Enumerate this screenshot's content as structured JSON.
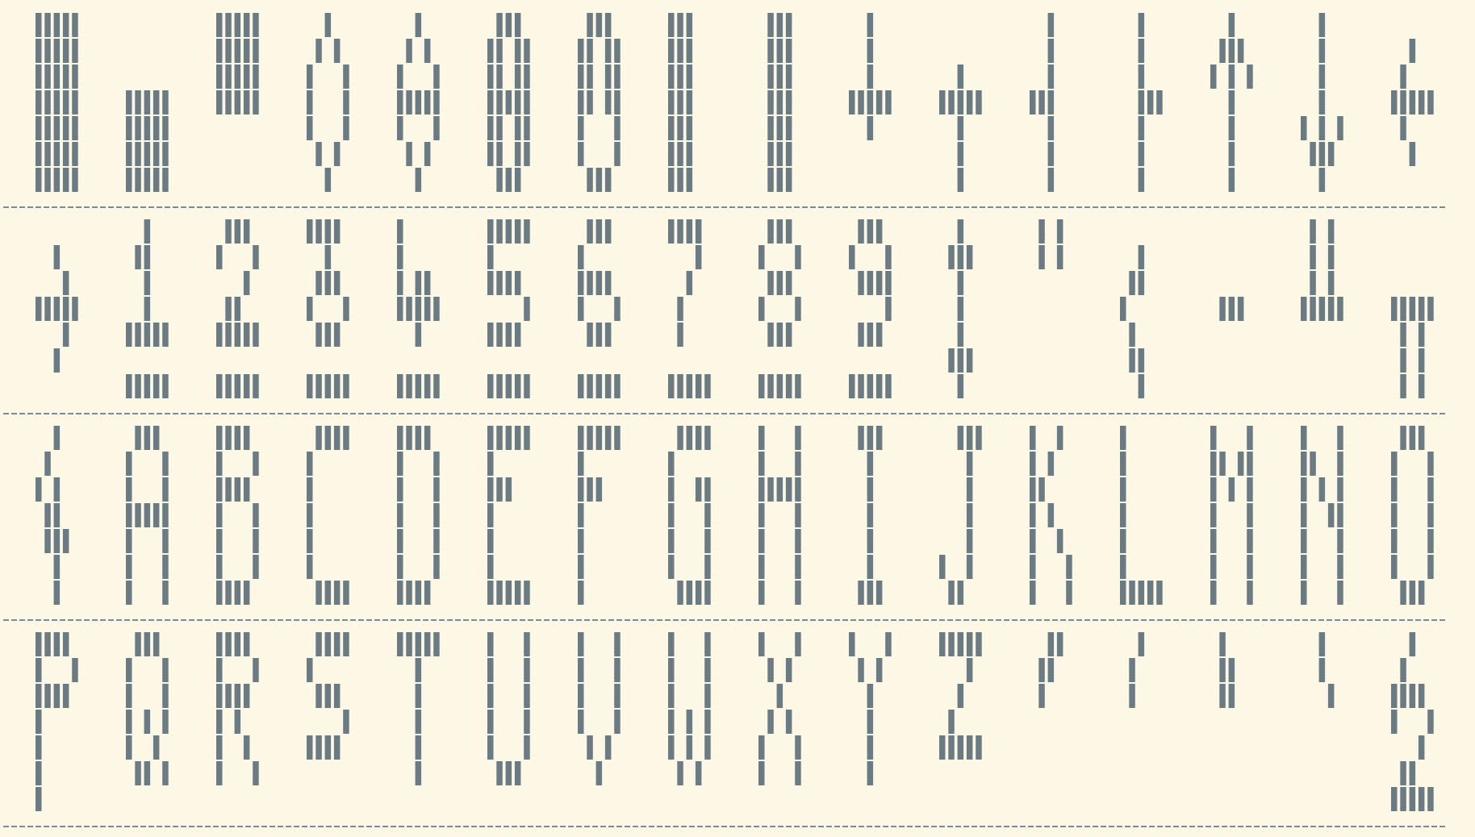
{
  "sheet": {
    "title": "",
    "colors": {
      "background": "#fdf7e6",
      "ink": "#6b7b83",
      "divider": "#7d8a91"
    },
    "cell": {
      "cols": 5,
      "rows": 7
    },
    "glyph_rows": [
      {
        "name": "graphics",
        "glyphs": [
          {
            "name": "full-block",
            "rows": [
              "11111",
              "11111",
              "11111",
              "11111",
              "11111",
              "11111",
              "11111"
            ]
          },
          {
            "name": "lower-block",
            "rows": [
              "00000",
              "00000",
              "00000",
              "11111",
              "11111",
              "11111",
              "11111"
            ]
          },
          {
            "name": "upper-block",
            "rows": [
              "11111",
              "11111",
              "11111",
              "11111",
              "00000",
              "00000",
              "00000"
            ]
          },
          {
            "name": "diamond-outline",
            "rows": [
              "00100",
              "01010",
              "10001",
              "10001",
              "10001",
              "01010",
              "00100"
            ]
          },
          {
            "name": "diamond-split",
            "rows": [
              "00100",
              "01010",
              "10001",
              "11111",
              "10001",
              "01010",
              "00100"
            ]
          },
          {
            "name": "rounded-bar",
            "rows": [
              "01110",
              "11011",
              "11011",
              "11111",
              "11011",
              "11011",
              "01110"
            ]
          },
          {
            "name": "battery",
            "rows": [
              "01110",
              "11011",
              "11011",
              "11011",
              "10001",
              "10001",
              "01110"
            ]
          },
          {
            "name": "left-half-block",
            "rows": [
              "11100",
              "11100",
              "11100",
              "11100",
              "11100",
              "11100",
              "11100"
            ]
          },
          {
            "name": "center-bar",
            "rows": [
              "01110",
              "01110",
              "01110",
              "01110",
              "01110",
              "01110",
              "01110"
            ]
          },
          {
            "name": "box-cross-up",
            "rows": [
              "00100",
              "00100",
              "00100",
              "11111",
              "00100",
              "00000",
              "00000"
            ]
          },
          {
            "name": "box-cross-down",
            "rows": [
              "00000",
              "00000",
              "00100",
              "11111",
              "00100",
              "00100",
              "00100"
            ]
          },
          {
            "name": "box-tee-left",
            "rows": [
              "00100",
              "00100",
              "00100",
              "11100",
              "00100",
              "00100",
              "00100"
            ]
          },
          {
            "name": "box-tee-right",
            "rows": [
              "00100",
              "00100",
              "00100",
              "00111",
              "00100",
              "00100",
              "00100"
            ]
          },
          {
            "name": "arrow-up",
            "rows": [
              "00100",
              "01110",
              "10101",
              "00100",
              "00100",
              "00100",
              "00100"
            ]
          },
          {
            "name": "arrow-down",
            "rows": [
              "00100",
              "00100",
              "00100",
              "00100",
              "10101",
              "01110",
              "00100"
            ]
          },
          {
            "name": "arrow-left",
            "rows": [
              "00000",
              "00100",
              "01000",
              "11111",
              "01000",
              "00100",
              "00000"
            ]
          }
        ]
      },
      {
        "name": "digits",
        "glyphs": [
          {
            "name": "arrow-right",
            "rows": [
              "00000",
              "00100",
              "00010",
              "11111",
              "00010",
              "00100",
              "00000"
            ]
          },
          {
            "name": "digit-1-underline",
            "rows": [
              "00100",
              "01100",
              "00100",
              "00100",
              "11111",
              "00000",
              "11111"
            ]
          },
          {
            "name": "digit-2-underline",
            "rows": [
              "01110",
              "10001",
              "00010",
              "01100",
              "11111",
              "00000",
              "11111"
            ]
          },
          {
            "name": "digit-3-underline",
            "rows": [
              "11110",
              "00100",
              "01110",
              "10001",
              "01110",
              "00000",
              "11111"
            ]
          },
          {
            "name": "digit-4-underline",
            "rows": [
              "10000",
              "10000",
              "10110",
              "11111",
              "00100",
              "00000",
              "11111"
            ]
          },
          {
            "name": "digit-5-underline",
            "rows": [
              "11111",
              "10000",
              "11110",
              "00001",
              "11110",
              "00000",
              "11111"
            ]
          },
          {
            "name": "digit-6-underline",
            "rows": [
              "01110",
              "10000",
              "11110",
              "10001",
              "01110",
              "00000",
              "11111"
            ]
          },
          {
            "name": "digit-7-underline",
            "rows": [
              "11110",
              "00010",
              "00100",
              "01000",
              "01000",
              "00000",
              "11111"
            ]
          },
          {
            "name": "digit-8-underline",
            "rows": [
              "01110",
              "10001",
              "01110",
              "10001",
              "01110",
              "00000",
              "11111"
            ]
          },
          {
            "name": "digit-9-underline",
            "rows": [
              "01110",
              "10001",
              "01111",
              "00001",
              "01110",
              "00000",
              "11111"
            ]
          },
          {
            "name": "updown-arrow",
            "rows": [
              "00100",
              "01110",
              "00100",
              "00100",
              "00100",
              "01110",
              "00100"
            ]
          },
          {
            "name": "double-quote",
            "rows": [
              "01010",
              "01010",
              "00000",
              "00000",
              "00000",
              "00000",
              "00000"
            ]
          },
          {
            "name": "left-brace",
            "rows": [
              "00000",
              "00100",
              "01100",
              "10000",
              "01000",
              "01100",
              "00100"
            ]
          },
          {
            "name": "minus",
            "rows": [
              "00000",
              "00000",
              "00000",
              "01110",
              "00000",
              "00000",
              "00000"
            ]
          },
          {
            "name": "underscore-bar",
            "rows": [
              "01010",
              "01010",
              "01010",
              "11111",
              "00000",
              "00000",
              "00000"
            ]
          },
          {
            "name": "pi",
            "rows": [
              "00000",
              "00000",
              "00000",
              "11111",
              "01010",
              "01010",
              "01010"
            ]
          }
        ]
      },
      {
        "name": "letters-a-o",
        "glyphs": [
          {
            "name": "at-sign",
            "rows": [
              "00100",
              "01000",
              "10100",
              "01100",
              "01110",
              "00100",
              "00100"
            ]
          },
          {
            "name": "letter-a",
            "rows": [
              "01110",
              "10001",
              "10001",
              "11111",
              "10001",
              "10001",
              "10001"
            ]
          },
          {
            "name": "letter-b",
            "rows": [
              "11110",
              "10001",
              "11110",
              "10001",
              "10001",
              "10001",
              "11110"
            ]
          },
          {
            "name": "letter-c",
            "rows": [
              "01111",
              "10000",
              "10000",
              "10000",
              "10000",
              "10000",
              "01111"
            ]
          },
          {
            "name": "letter-d",
            "rows": [
              "11110",
              "10001",
              "10001",
              "10001",
              "10001",
              "10001",
              "11110"
            ]
          },
          {
            "name": "letter-e",
            "rows": [
              "11111",
              "10000",
              "11100",
              "10000",
              "10000",
              "10000",
              "11111"
            ]
          },
          {
            "name": "letter-f",
            "rows": [
              "11111",
              "10000",
              "11100",
              "10000",
              "10000",
              "10000",
              "10000"
            ]
          },
          {
            "name": "letter-g",
            "rows": [
              "01111",
              "10000",
              "10011",
              "10001",
              "10001",
              "10001",
              "01111"
            ]
          },
          {
            "name": "letter-h",
            "rows": [
              "10001",
              "10001",
              "11111",
              "10001",
              "10001",
              "10001",
              "10001"
            ]
          },
          {
            "name": "letter-i",
            "rows": [
              "01110",
              "00100",
              "00100",
              "00100",
              "00100",
              "00100",
              "01110"
            ]
          },
          {
            "name": "letter-j",
            "rows": [
              "00111",
              "00010",
              "00010",
              "00010",
              "00010",
              "10010",
              "01100"
            ]
          },
          {
            "name": "letter-k",
            "rows": [
              "10010",
              "10100",
              "11000",
              "10100",
              "10010",
              "10001",
              "10001"
            ]
          },
          {
            "name": "letter-l",
            "rows": [
              "10000",
              "10000",
              "10000",
              "10000",
              "10000",
              "10000",
              "11111"
            ]
          },
          {
            "name": "letter-m",
            "rows": [
              "10001",
              "11011",
              "10101",
              "10001",
              "10001",
              "10001",
              "10001"
            ]
          },
          {
            "name": "letter-n",
            "rows": [
              "10001",
              "11001",
              "10101",
              "10011",
              "10001",
              "10001",
              "10001"
            ]
          },
          {
            "name": "letter-o",
            "rows": [
              "01110",
              "10001",
              "10001",
              "10001",
              "10001",
              "10001",
              "01110"
            ]
          }
        ]
      },
      {
        "name": "letters-p-z",
        "glyphs": [
          {
            "name": "letter-p",
            "rows": [
              "11110",
              "10001",
              "11110",
              "10000",
              "10000",
              "10000",
              "10000"
            ]
          },
          {
            "name": "letter-q",
            "rows": [
              "01110",
              "10001",
              "10001",
              "10101",
              "10010",
              "01101",
              "00000"
            ]
          },
          {
            "name": "letter-r",
            "rows": [
              "11110",
              "10001",
              "11110",
              "10100",
              "10010",
              "10001",
              "00000"
            ]
          },
          {
            "name": "letter-s",
            "rows": [
              "01111",
              "10000",
              "01110",
              "00001",
              "11110",
              "00000",
              "00000"
            ]
          },
          {
            "name": "letter-t",
            "rows": [
              "11111",
              "00100",
              "00100",
              "00100",
              "00100",
              "00100",
              "00000"
            ]
          },
          {
            "name": "letter-u",
            "rows": [
              "10001",
              "10001",
              "10001",
              "10001",
              "10001",
              "01110",
              "00000"
            ]
          },
          {
            "name": "letter-v",
            "rows": [
              "10001",
              "10001",
              "10001",
              "10001",
              "01010",
              "00100",
              "00000"
            ]
          },
          {
            "name": "letter-w",
            "rows": [
              "10001",
              "10001",
              "10001",
              "10101",
              "10101",
              "01010",
              "00000"
            ]
          },
          {
            "name": "letter-x",
            "rows": [
              "10001",
              "01010",
              "00100",
              "01010",
              "10001",
              "10001",
              "00000"
            ]
          },
          {
            "name": "letter-y",
            "rows": [
              "10001",
              "01010",
              "00100",
              "00100",
              "00100",
              "00100",
              "00000"
            ]
          },
          {
            "name": "letter-z",
            "rows": [
              "11111",
              "00010",
              "00100",
              "01000",
              "11111",
              "00000",
              "00000"
            ]
          },
          {
            "name": "prime-double",
            "rows": [
              "00110",
              "01100",
              "01000",
              "00000",
              "00000",
              "00000",
              "00000"
            ]
          },
          {
            "name": "prime-single",
            "rows": [
              "00100",
              "01000",
              "01000",
              "00000",
              "00000",
              "00000",
              "00000"
            ]
          },
          {
            "name": "backslash-mark",
            "rows": [
              "01000",
              "01100",
              "01100",
              "00000",
              "00000",
              "00000",
              "00000"
            ]
          },
          {
            "name": "grave-mark",
            "rows": [
              "00100",
              "00100",
              "00010",
              "00000",
              "00000",
              "00000",
              "00000"
            ]
          },
          {
            "name": "section-sign",
            "rows": [
              "00100",
              "01000",
              "11110",
              "10001",
              "00010",
              "01100",
              "11111"
            ]
          }
        ]
      }
    ]
  }
}
